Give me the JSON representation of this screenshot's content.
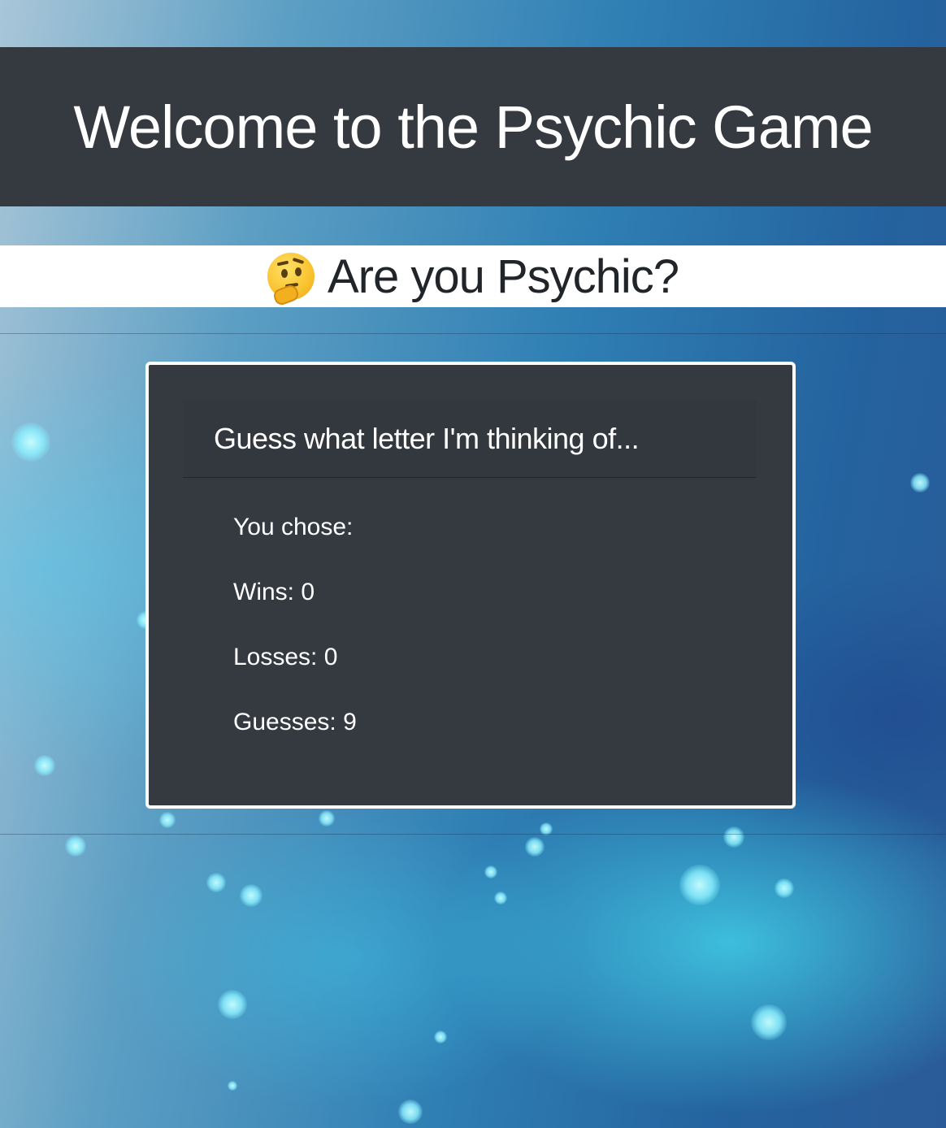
{
  "header": {
    "title": "Welcome to the Psychic Game"
  },
  "subheader": {
    "emoji": "thinking-face",
    "text": "Are you Psychic?"
  },
  "game_card": {
    "prompt": "Guess what letter I'm thinking of...",
    "stats": {
      "chose_label": "You chose:",
      "chose_value": "",
      "wins_label": "Wins:",
      "wins_value": "0",
      "losses_label": "Losses:",
      "losses_value": "0",
      "guesses_label": "Guesses:",
      "guesses_value": "9"
    }
  },
  "colors": {
    "dark_panel": "#343a40",
    "white": "#ffffff",
    "text_dark": "#212529",
    "background_blue": "#2f7fb4"
  }
}
